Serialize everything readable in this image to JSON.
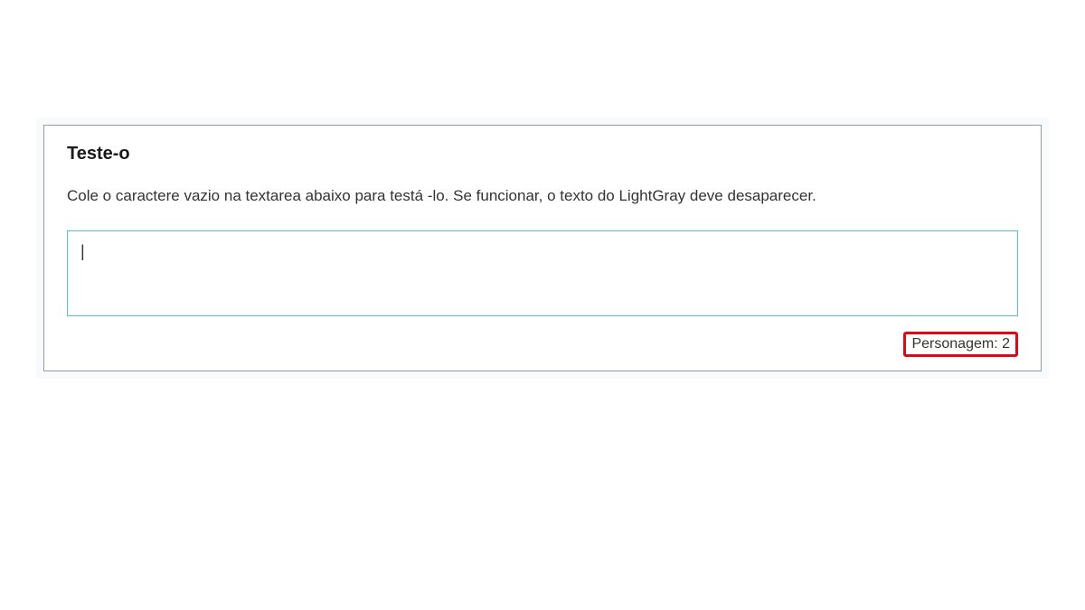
{
  "card": {
    "title": "Teste-o",
    "description": "Cole o caractere vazio na textarea abaixo para testá -lo. Se funcionar, o texto do LightGray deve desaparecer.",
    "textarea_value": "|",
    "counter_label": "Personagem: ",
    "counter_value": "2"
  }
}
